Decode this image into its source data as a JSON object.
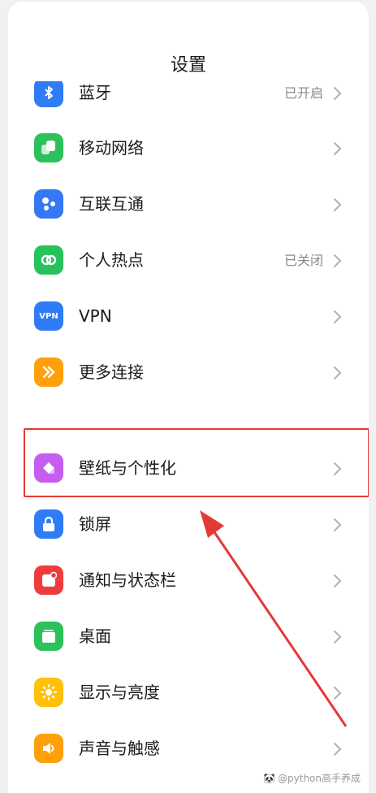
{
  "header": {
    "title": "设置"
  },
  "partial_row": {
    "label": "蓝牙",
    "value": "已开启",
    "color": "#2f7cf6",
    "icon": "bluetooth-icon"
  },
  "rows_a": [
    {
      "label": "移动网络",
      "value": "",
      "color": "#2cc15a",
      "icon": "mobile-network-icon"
    },
    {
      "label": "互联互通",
      "value": "",
      "color": "#3478f6",
      "icon": "interconnect-icon"
    },
    {
      "label": "个人热点",
      "value": "已关闭",
      "color": "#27c25c",
      "icon": "hotspot-icon"
    },
    {
      "label": "VPN",
      "value": "",
      "color": "#2f7cf6",
      "icon": "vpn-icon",
      "icon_text": "VPN"
    },
    {
      "label": "更多连接",
      "value": "",
      "color": "#ff9f0a",
      "icon": "more-connections-icon"
    }
  ],
  "rows_b": [
    {
      "label": "壁纸与个性化",
      "value": "",
      "color": "#c55df0",
      "icon": "wallpaper-icon"
    },
    {
      "label": "锁屏",
      "value": "",
      "color": "#2f7cf6",
      "icon": "lock-icon"
    },
    {
      "label": "通知与状态栏",
      "value": "",
      "color": "#ef3b3b",
      "icon": "notification-icon"
    },
    {
      "label": "桌面",
      "value": "",
      "color": "#2cc15a",
      "icon": "desktop-icon"
    },
    {
      "label": "显示与亮度",
      "value": "",
      "color": "#ffc107",
      "icon": "brightness-icon"
    },
    {
      "label": "声音与触感",
      "value": "",
      "color": "#ff9f0a",
      "icon": "sound-icon"
    }
  ],
  "watermark": {
    "text": "@python高手养成",
    "icon": "watermark-logo-icon"
  },
  "annotation": {
    "color": "#e53935"
  }
}
